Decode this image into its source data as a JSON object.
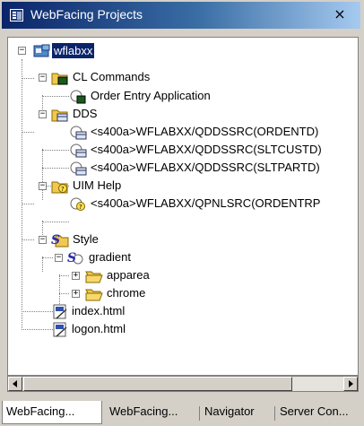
{
  "window": {
    "title": "WebFacing Projects",
    "close_glyph": "×"
  },
  "tree": [
    {
      "label": "wflabxx",
      "icon": "project-icon",
      "selected": true
    },
    {
      "label": "CL Commands",
      "icon": "cl-folder-icon"
    },
    {
      "label": "Order Entry Application",
      "icon": "cl-command-icon"
    },
    {
      "label": "DDS",
      "icon": "dds-folder-icon"
    },
    {
      "label": "<s400a>WFLABXX/QDDSSRC(ORDENTD)",
      "icon": "dds-member-icon"
    },
    {
      "label": "<s400a>WFLABXX/QDDSSRC(SLTCUSTD)",
      "icon": "dds-member-icon"
    },
    {
      "label": "<s400a>WFLABXX/QDDSSRC(SLTPARTD)",
      "icon": "dds-member-icon"
    },
    {
      "label": "UIM Help",
      "icon": "uim-folder-icon"
    },
    {
      "label": "<s400a>WFLABXX/QPNLSRC(ORDENTRP",
      "icon": "uim-member-icon"
    },
    {
      "label": "Style",
      "icon": "style-folder-icon"
    },
    {
      "label": "gradient",
      "icon": "style-icon"
    },
    {
      "label": "apparea",
      "icon": "folder-icon"
    },
    {
      "label": "chrome",
      "icon": "folder-icon"
    },
    {
      "label": "index.html",
      "icon": "html-file-icon"
    },
    {
      "label": "logon.html",
      "icon": "html-file-icon"
    }
  ],
  "expander": {
    "expanded": "−",
    "collapsed": "+"
  },
  "tabs": [
    {
      "label": "WebFacing...",
      "active": true
    },
    {
      "label": "WebFacing...",
      "active": false
    },
    {
      "label": "Navigator",
      "active": false
    },
    {
      "label": "Server Con...",
      "active": false
    }
  ],
  "colors": {
    "selection": "#0a246a",
    "folder": "#f0c850",
    "title_start": "#0a246a",
    "title_end": "#a6caf0"
  }
}
